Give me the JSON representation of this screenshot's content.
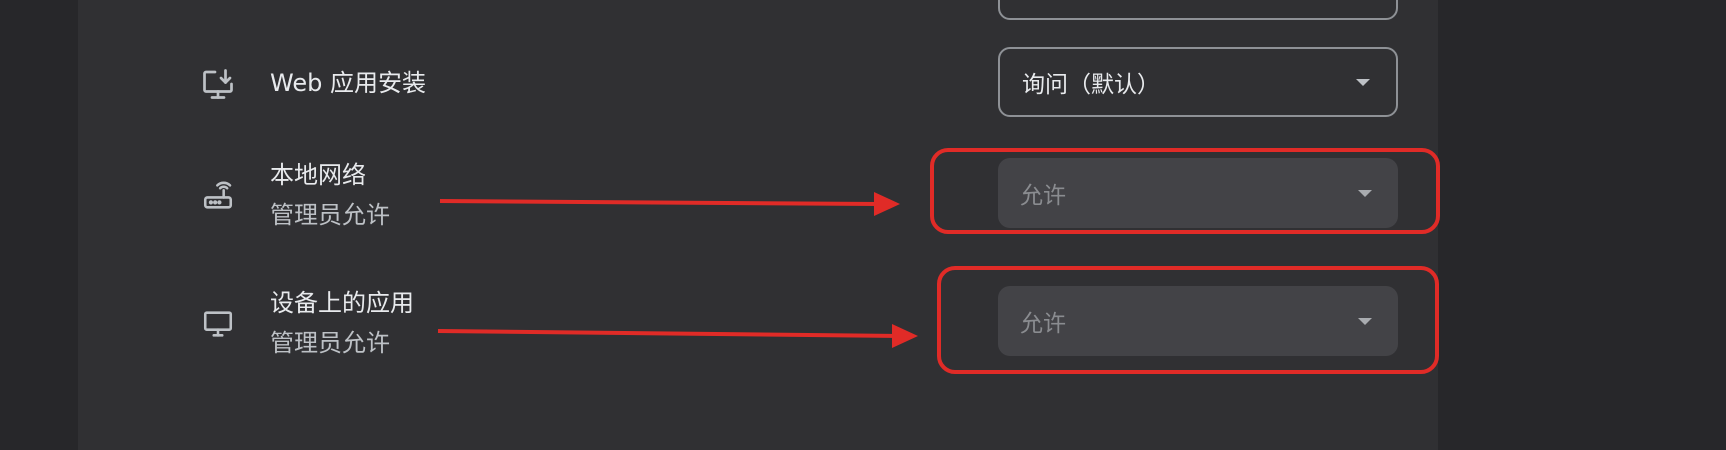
{
  "rows": {
    "top_partial": {
      "title": ""
    },
    "web_app_install": {
      "title": "Web 应用安装",
      "select_value": "询问（默认）",
      "icon": "install-desktop-icon"
    },
    "local_network": {
      "title": "本地网络",
      "subtitle": "管理员允许",
      "select_value": "允许",
      "icon": "router-icon"
    },
    "device_apps": {
      "title": "设备上的应用",
      "subtitle": "管理员允许",
      "select_value": "允许",
      "icon": "monitor-icon"
    }
  },
  "annotations": {
    "color": "#e02b27"
  },
  "colors": {
    "background": "#27272a",
    "panel": "#303033",
    "text_primary": "#e8eaed",
    "text_secondary": "#bdc1c6"
  }
}
